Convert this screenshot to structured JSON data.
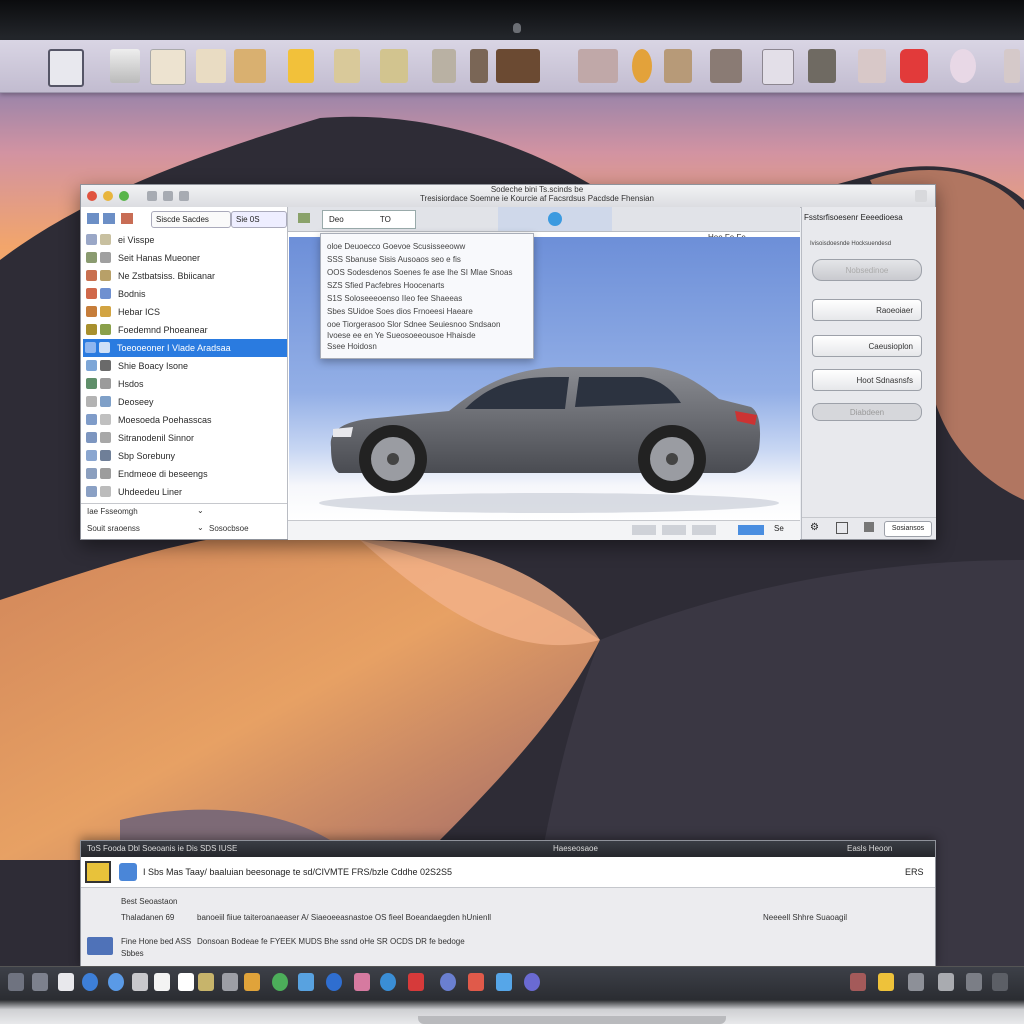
{
  "window": {
    "title_line1": "Sodeche bini Ts.scinds be",
    "title_line2": "Tresisiordace Soemne ie Kourcie af Facsrdsus Pacdsde Fhensian",
    "colors": {
      "close": "#e0533f",
      "minimize": "#e8b53d",
      "zoom": "#58b54a",
      "selection": "#2a7be0"
    }
  },
  "sidebar": {
    "search_label": "Siscde Sacdes",
    "search_badge": "Sie 0S",
    "items": [
      {
        "label": "ei Visspe"
      },
      {
        "label": "Seit Hanas Mueoner"
      },
      {
        "label": "Ne Zstbatsiss. Bbiicanar"
      },
      {
        "label": "Bodnis"
      },
      {
        "label": "Hebar ICS"
      },
      {
        "label": "Foedemnd Phoeanear"
      },
      {
        "label": "Toeooeoner I Vlade Aradsaa",
        "selected": true
      },
      {
        "label": "Shie Boacy Isone"
      },
      {
        "label": "Hsdos"
      },
      {
        "label": "Deoseey"
      },
      {
        "label": "Moesoeda Poehasscas"
      },
      {
        "label": "Sitranodenil Sinnor"
      },
      {
        "label": "Sbp Sorebuny"
      },
      {
        "label": "Endmeoe di beseengs"
      },
      {
        "label": "Uhdeedeu Liner"
      }
    ],
    "footer_label1": "Iae Fsseomgh",
    "footer_label2": "Souit sraoenss",
    "footer_label3": "Sosocbsoe"
  },
  "center": {
    "tab1": "Deo",
    "tab2": "TO",
    "toolbar_right": "Hoe Fe Fe",
    "popup_items": [
      "oloe  Deuoecco Goevoe Scusisseeoww",
      "SSS  Sbanuse  Sisis Ausoaos seo e fis",
      "OOS  Sodesdenos Soenes fe ase Ihe SI Mlae Snoas",
      "SZS  Sfied Pacfebres  Hoocenarts",
      "S1S  Soloseeeoenso IIeo fee Shaeeas",
      "Sbes  SUidoe Soes dios Frnoeesi Haeare",
      "ooe  Tiorgerasoo Slor Sdnee Seuiesnoo Sndsaon",
      "Ivoese ee en Ye Sueosoeeousoe Hhaisde",
      "Ssee Hoidosn"
    ],
    "status_right": "Se"
  },
  "inspector": {
    "title": "Fsstsrfisoesenr Eeeedioesa",
    "subtitle": "Ivisoisdoesnde Hocksuendesd",
    "btn1": "Nobsedinoe",
    "btn2": "Raoeoiaer",
    "btn3": "Caeusioplon",
    "btn4": "Hoot Sdnasnsfs",
    "btn5": "Diabdeen",
    "footer_btn": "Sosiansos"
  },
  "bottom_panel": {
    "title_left": "ToS  Fooda  Dbl Soeoanis ie Dis SDS IUSE",
    "title_center": "Haeseosaoe",
    "title_right": "Easls  Heoon",
    "row1": "I Sbs Mas Taay/ baaluian beesonage te sd/CIVMTE FRS/bzle Cddhe 02S2S5",
    "row1_right": "ERS",
    "line1": "Best Seoastaon",
    "line2_left": "Thaladanen 69",
    "line2_mid": "banoeiil fiiue taiteroanaeaser A/ Siaeoeeasnastoe OS fieel Boeandaegden hUnienll",
    "line2_right": "Neeeell Shhre Suaoagil",
    "line3_left": "Fine Hone bed ASS",
    "line3_sub": "Sbbes",
    "line3_mid": "Donsoan Bodeae fe FYEEK MUDS Bhe ssnd  oHe SR OCDS  DR fe bedoge"
  }
}
